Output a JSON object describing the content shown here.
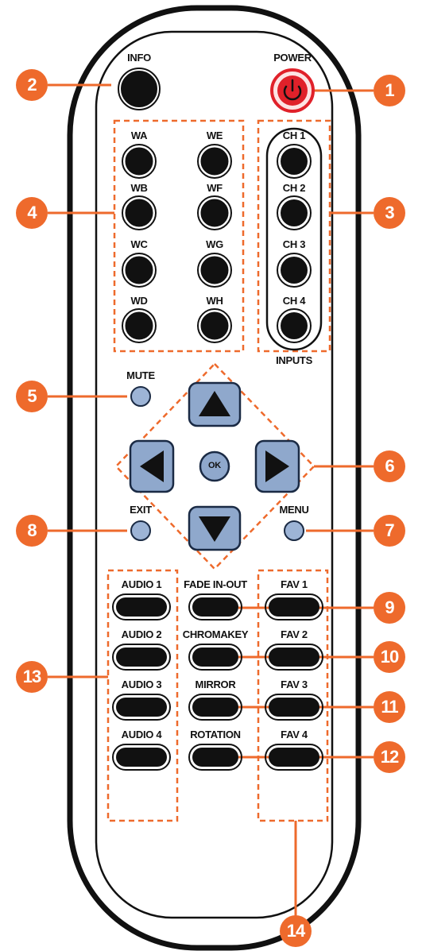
{
  "remote": {
    "colors": {
      "callout": "#ee6a2c",
      "button_dark": "#111111",
      "nav_blue": "#8fa8cc",
      "power_red": "#e0212a",
      "outline": "#1a1a1a"
    },
    "labels": {
      "info": "INFO",
      "power": "POWER",
      "wa": "WA",
      "wb": "WB",
      "wc": "WC",
      "wd": "WD",
      "we": "WE",
      "wf": "WF",
      "wg": "WG",
      "wh": "WH",
      "ch1": "CH 1",
      "ch2": "CH 2",
      "ch3": "CH 3",
      "ch4": "CH 4",
      "inputs": "INPUTS",
      "mute": "MUTE",
      "ok": "OK",
      "exit": "EXIT",
      "menu": "MENU",
      "audio1": "AUDIO 1",
      "audio2": "AUDIO 2",
      "audio3": "AUDIO 3",
      "audio4": "AUDIO 4",
      "fade": "FADE IN-OUT",
      "chromakey": "CHROMAKEY",
      "mirror": "MIRROR",
      "rotation": "ROTATION",
      "fav1": "FAV 1",
      "fav2": "FAV 2",
      "fav3": "FAV 3",
      "fav4": "FAV 4"
    },
    "callouts": [
      "1",
      "2",
      "3",
      "4",
      "5",
      "6",
      "7",
      "8",
      "9",
      "10",
      "11",
      "12",
      "13",
      "14"
    ]
  }
}
